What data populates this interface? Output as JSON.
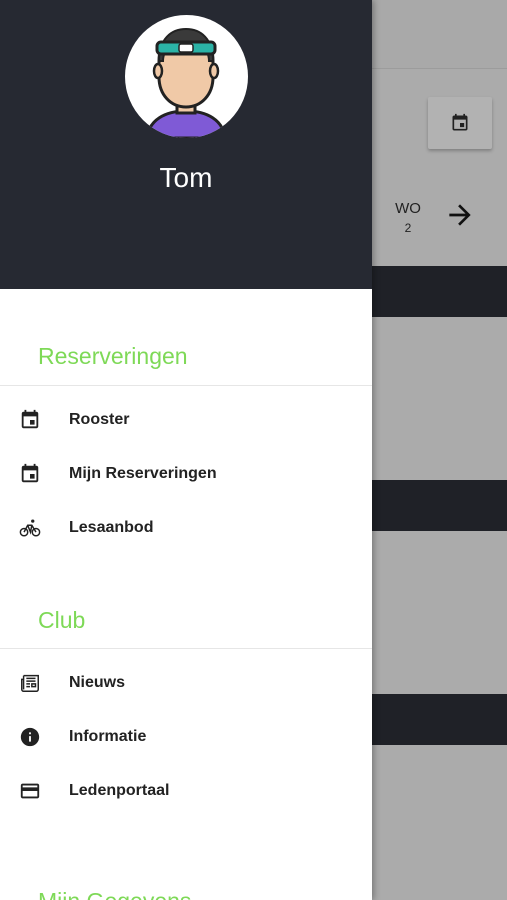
{
  "user": {
    "name": "Tom"
  },
  "sections": [
    {
      "title": "Reserveringen",
      "items": [
        {
          "label": "Rooster",
          "icon": "calendar-icon"
        },
        {
          "label": "Mijn Reserveringen",
          "icon": "calendar-icon"
        },
        {
          "label": "Lesaanbod",
          "icon": "bicycle-icon"
        }
      ]
    },
    {
      "title": "Club",
      "items": [
        {
          "label": "Nieuws",
          "icon": "newspaper-icon"
        },
        {
          "label": "Informatie",
          "icon": "info-icon"
        },
        {
          "label": "Ledenportaal",
          "icon": "credit-card-icon"
        }
      ]
    },
    {
      "title": "Mijn Gegevens",
      "items": []
    }
  ],
  "background": {
    "day_name": "WO",
    "day_number": "2"
  },
  "colors": {
    "header_bg": "#262932",
    "section_title": "#7ed957",
    "overlay": "#ababab"
  }
}
